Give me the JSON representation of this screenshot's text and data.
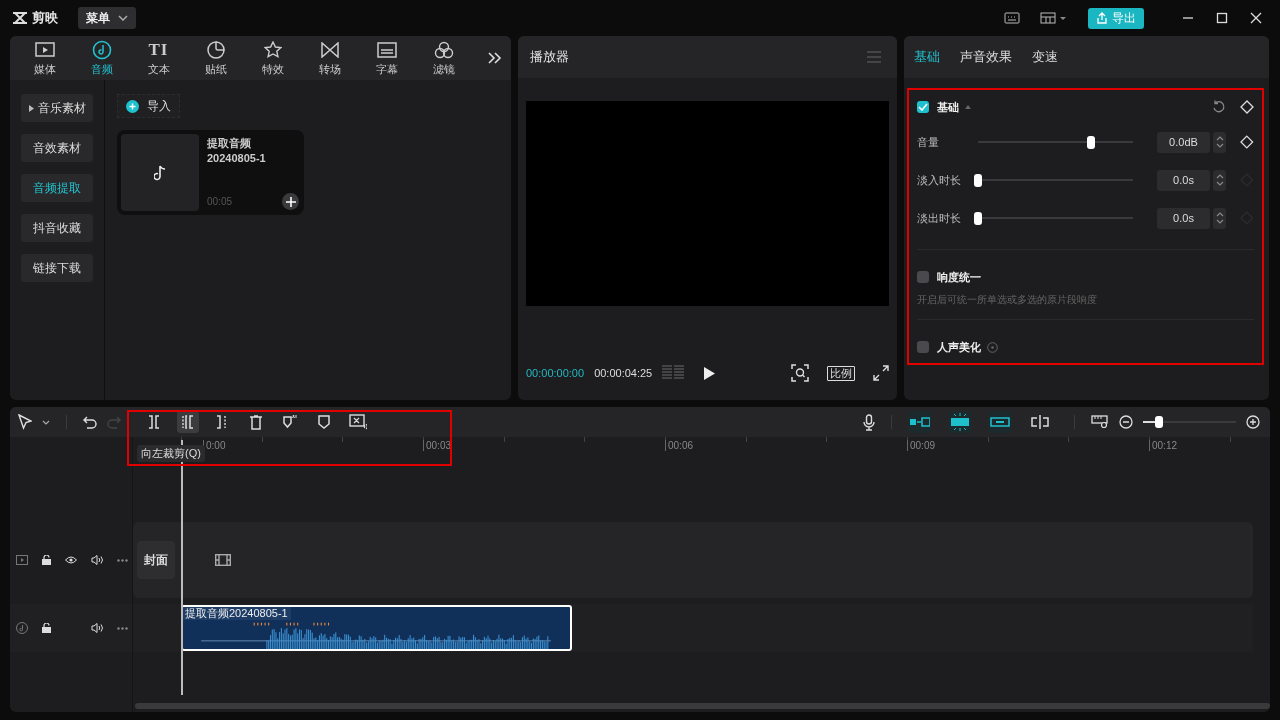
{
  "app": {
    "name": "剪映",
    "menu": "菜单",
    "export": "导出"
  },
  "media_tabs": [
    {
      "label": "媒体",
      "kind": "media",
      "selected": false
    },
    {
      "label": "音频",
      "kind": "audio",
      "selected": true
    },
    {
      "label": "文本",
      "kind": "text",
      "icon_text": "TI",
      "selected": false
    },
    {
      "label": "贴纸",
      "kind": "sticker",
      "selected": false
    },
    {
      "label": "特效",
      "kind": "effect",
      "selected": false
    },
    {
      "label": "转场",
      "kind": "transition",
      "selected": false
    },
    {
      "label": "字幕",
      "kind": "caption",
      "selected": false
    },
    {
      "label": "滤镜",
      "kind": "filter",
      "selected": false
    }
  ],
  "media_sidebar": [
    {
      "label": "音乐素材",
      "expandable": true,
      "selected": false
    },
    {
      "label": "音效素材",
      "expandable": false,
      "selected": false
    },
    {
      "label": "音频提取",
      "expandable": false,
      "selected": true
    },
    {
      "label": "抖音收藏",
      "expandable": false,
      "selected": false
    },
    {
      "label": "链接下载",
      "expandable": false,
      "selected": false
    }
  ],
  "import_button": "导入",
  "assets": [
    {
      "title": "提取音频",
      "subtitle": "20240805-1",
      "duration": "00:05"
    }
  ],
  "player": {
    "title": "播放器",
    "current_time": "00:00:00:00",
    "total_time": "00:00:04:25",
    "ratio": "比例"
  },
  "inspector_tabs": [
    {
      "label": "基础",
      "selected": true
    },
    {
      "label": "声音效果",
      "selected": false
    },
    {
      "label": "变速",
      "selected": false
    }
  ],
  "basic_section": {
    "label": "基础",
    "checked": true
  },
  "sliders": [
    {
      "label": "音量",
      "level": 0.73,
      "value": "0.0dB",
      "keyframe_enabled": true
    },
    {
      "label": "淡入时长",
      "level": 0,
      "value": "0.0s",
      "keyframe_enabled": false
    },
    {
      "label": "淡出时长",
      "level": 0,
      "value": "0.0s",
      "keyframe_enabled": false
    }
  ],
  "loudness": {
    "label": "响度统一",
    "checked": false,
    "hint": "开启后可统一所单选或多选的原片段响度"
  },
  "voice_enhance": {
    "label": "人声美化",
    "checked": false
  },
  "edit_tools": [
    {
      "kind": "split",
      "highlighted": false
    },
    {
      "kind": "trim-left",
      "highlighted": true
    },
    {
      "kind": "trim-right",
      "highlighted": false
    },
    {
      "kind": "delete",
      "highlighted": false
    },
    {
      "kind": "ai-mark",
      "highlighted": false
    },
    {
      "kind": "mark",
      "highlighted": false
    },
    {
      "kind": "separate-audio",
      "highlighted": false
    }
  ],
  "view_toggles": [
    {
      "kind": "main-track-magnet",
      "on": true
    },
    {
      "kind": "auto-snap",
      "on": true
    },
    {
      "kind": "linkage",
      "on": true
    },
    {
      "kind": "preview-axis",
      "on": false
    }
  ],
  "tooltip": "向左裁剪(Q)",
  "ruler_labels": [
    "0:00",
    "00:03",
    "00:06",
    "00:09",
    "00:12"
  ],
  "timeline_zoom": {
    "level": 0.17
  },
  "tracks": [
    {
      "kind": "video",
      "cover": "封面"
    },
    {
      "kind": "audio",
      "clip": "提取音频20240805-1"
    }
  ]
}
